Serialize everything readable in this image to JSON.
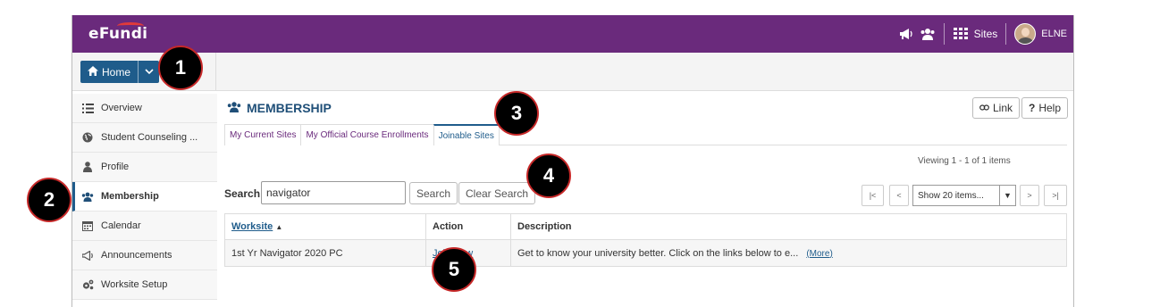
{
  "header": {
    "logo": "eFundi",
    "sites_label": "Sites",
    "user_label": "ELNE",
    "icons": [
      "megaphone-icon",
      "users-icon",
      "grid-icon",
      "avatar"
    ],
    "brand_color": "#6a2a7c"
  },
  "home_button": {
    "label": "Home"
  },
  "sidebar": {
    "items": [
      {
        "label": "Overview",
        "icon": "list-icon"
      },
      {
        "label": "Student Counseling ...",
        "icon": "globe-icon"
      },
      {
        "label": "Profile",
        "icon": "person-icon"
      },
      {
        "label": "Membership",
        "icon": "users-icon",
        "active": true
      },
      {
        "label": "Calendar",
        "icon": "calendar-icon"
      },
      {
        "label": "Announcements",
        "icon": "megaphone-icon"
      },
      {
        "label": "Worksite Setup",
        "icon": "gears-icon"
      }
    ]
  },
  "main": {
    "title": "MEMBERSHIP",
    "link_button": "Link",
    "help_button": "Help",
    "tabs": [
      {
        "label": "My Current Sites"
      },
      {
        "label": "My Official Course Enrollments"
      },
      {
        "label": "Joinable Sites",
        "active": true
      }
    ],
    "search": {
      "label": "Search",
      "value": "navigator",
      "search_button": "Search",
      "clear_button": "Clear Search"
    },
    "pager": {
      "viewing": "Viewing 1 - 1 of 1 items",
      "first": "|<",
      "prev": "<",
      "show": "Show 20 items...",
      "next": ">",
      "last": ">|"
    },
    "table": {
      "headers": [
        "Worksite",
        "Action",
        "Description"
      ],
      "rows": [
        {
          "worksite": "1st Yr Navigator 2020 PC",
          "action": "Join Now",
          "description": "Get to know your university better. Click on the links below to e...",
          "more": "(More)"
        }
      ]
    }
  },
  "callouts": [
    "1",
    "2",
    "3",
    "4",
    "5"
  ]
}
